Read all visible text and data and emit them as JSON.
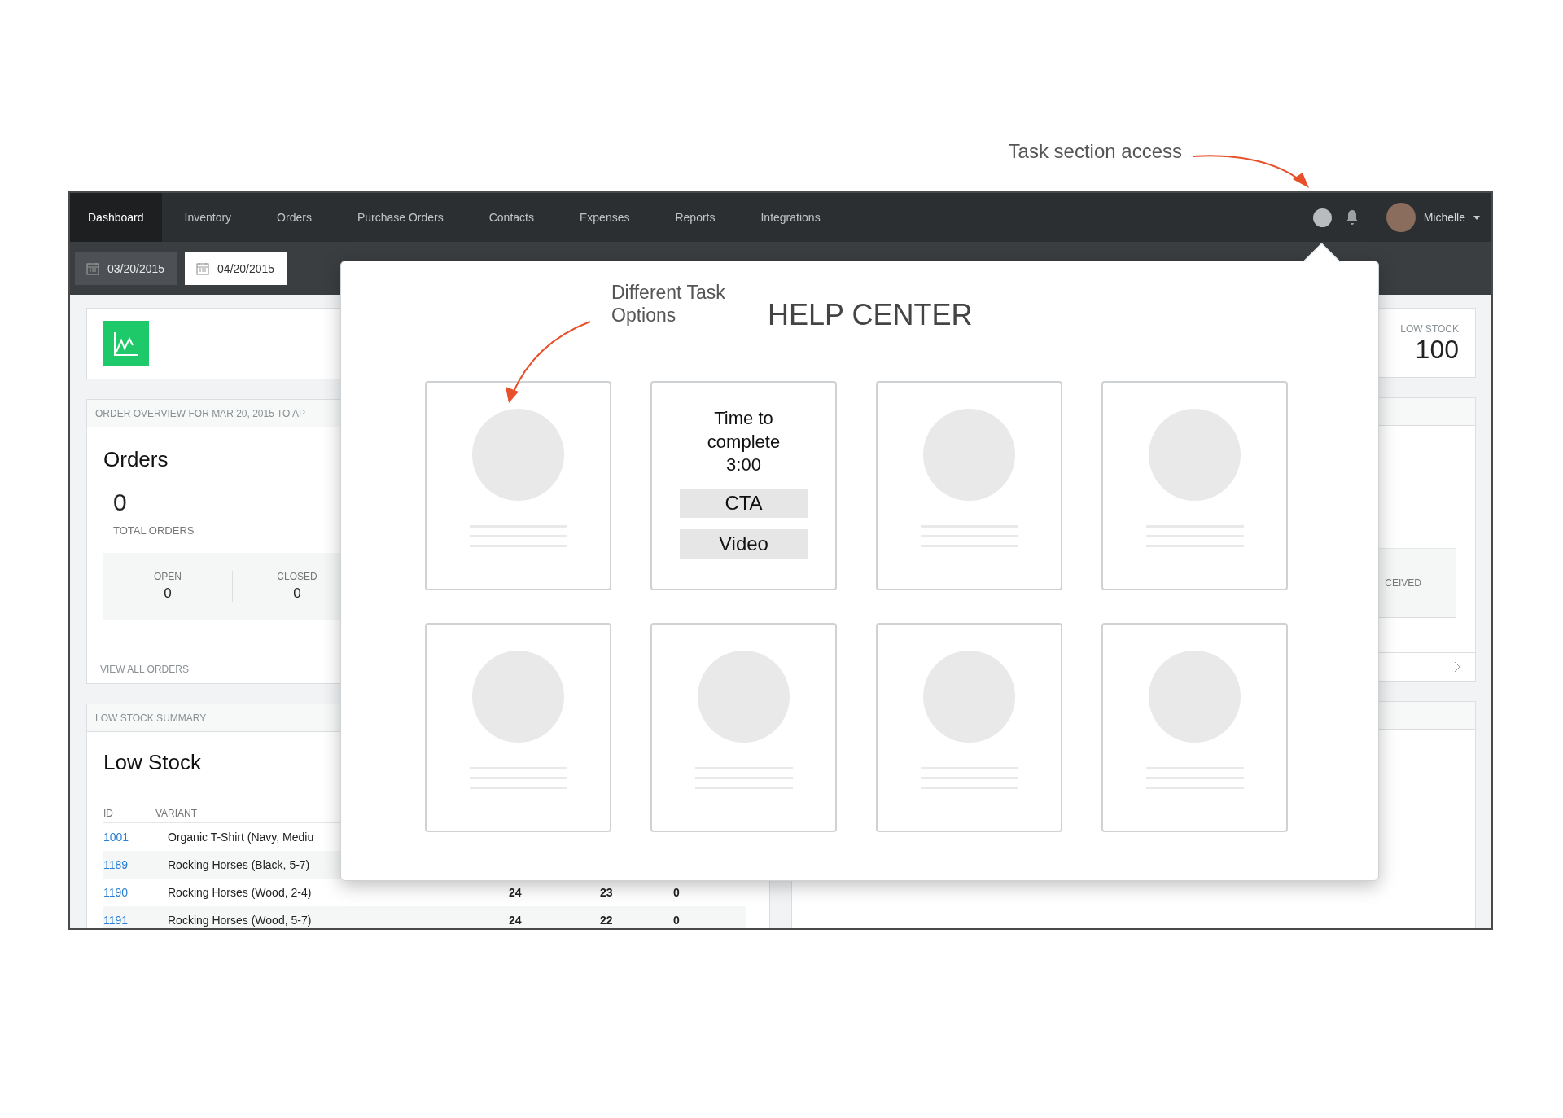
{
  "task_annotation": "Task section access",
  "nav": {
    "tabs": [
      {
        "label": "Dashboard",
        "selected": true
      },
      {
        "label": "Inventory",
        "selected": false
      },
      {
        "label": "Orders",
        "selected": false
      },
      {
        "label": "Purchase Orders",
        "selected": false
      },
      {
        "label": "Contacts",
        "selected": false
      },
      {
        "label": "Expenses",
        "selected": false
      },
      {
        "label": "Reports",
        "selected": false
      },
      {
        "label": "Integrations",
        "selected": false
      }
    ],
    "user": "Michelle"
  },
  "date_range": [
    {
      "label": "03/20/2015",
      "selected": false
    },
    {
      "label": "04/20/2015",
      "selected": true
    }
  ],
  "summary_card": {
    "label": "LOW STOCK",
    "value": "100"
  },
  "order_overview": {
    "header": "ORDER OVERVIEW FOR MAR 20, 2015 TO AP",
    "title": "Orders",
    "total": "0",
    "total_label": "TOTAL ORDERS",
    "stats": [
      {
        "label": "OPEN",
        "value": "0"
      },
      {
        "label": "CLOSED",
        "value": "0"
      }
    ],
    "footer": "VIEW ALL ORDERS"
  },
  "right_panel": {
    "stat_label": "CEIVED"
  },
  "low_stock": {
    "header": "LOW STOCK SUMMARY",
    "title": "Low Stock",
    "columns": [
      "ID",
      "VARIANT"
    ],
    "rows": [
      {
        "id": "1001",
        "variant": "Organic T-Shirt (Navy, Mediu"
      },
      {
        "id": "1189",
        "variant": "Rocking Horses (Black, 5-7)"
      },
      {
        "id": "1190",
        "variant": "Rocking Horses (Wood, 2-4)",
        "cells": [
          "24",
          "23",
          "0"
        ]
      },
      {
        "id": "1191",
        "variant": "Rocking Horses (Wood, 5-7)",
        "cells": [
          "24",
          "22",
          "0"
        ]
      }
    ]
  },
  "help_center": {
    "annotation": "Different Task Options",
    "title": "HELP CENTER",
    "cards": [
      {
        "kind": "placeholder"
      },
      {
        "kind": "task",
        "text": "Time to complete 3:00",
        "buttons": [
          "CTA",
          "Video"
        ]
      },
      {
        "kind": "placeholder"
      },
      {
        "kind": "placeholder"
      },
      {
        "kind": "placeholder"
      },
      {
        "kind": "placeholder"
      },
      {
        "kind": "placeholder"
      },
      {
        "kind": "placeholder"
      }
    ]
  }
}
